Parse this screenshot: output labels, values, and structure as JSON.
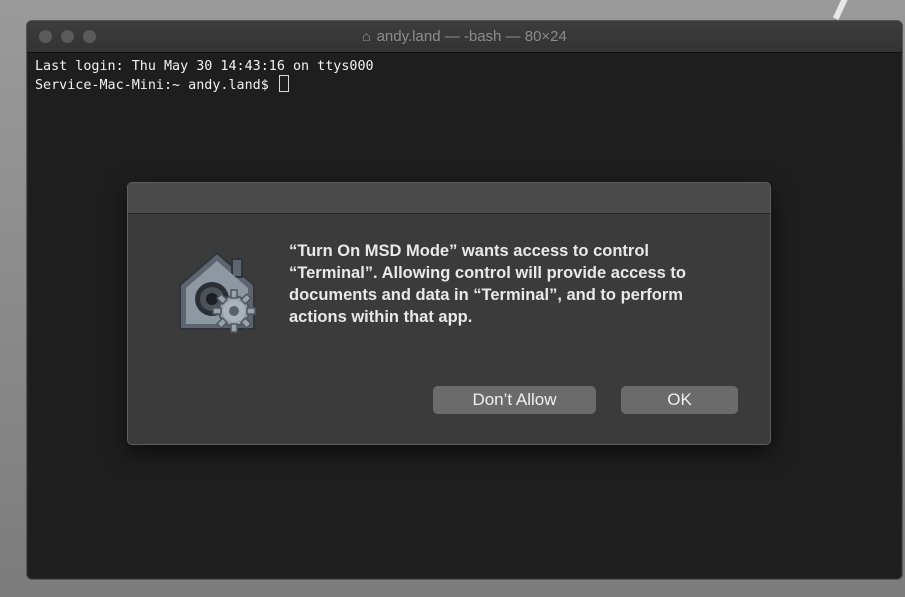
{
  "window": {
    "title": "andy.land — -bash — 80×24",
    "title_icon": "home-icon"
  },
  "terminal": {
    "line1": "Last login: Thu May 30 14:43:16 on ttys000",
    "prompt": "Service-Mac-Mini:~ andy.land$ "
  },
  "dialog": {
    "icon": "gear-house-icon",
    "message": "“Turn On MSD Mode” wants access to control “Terminal”. Allowing control will provide access to documents and data in “Terminal”, and to perform actions within that app.",
    "deny_label": "Don’t Allow",
    "ok_label": "OK"
  },
  "colors": {
    "terminal_bg": "#1e1e1e",
    "dialog_bg": "#3b3b3b",
    "button_bg": "#6b6b6b"
  }
}
